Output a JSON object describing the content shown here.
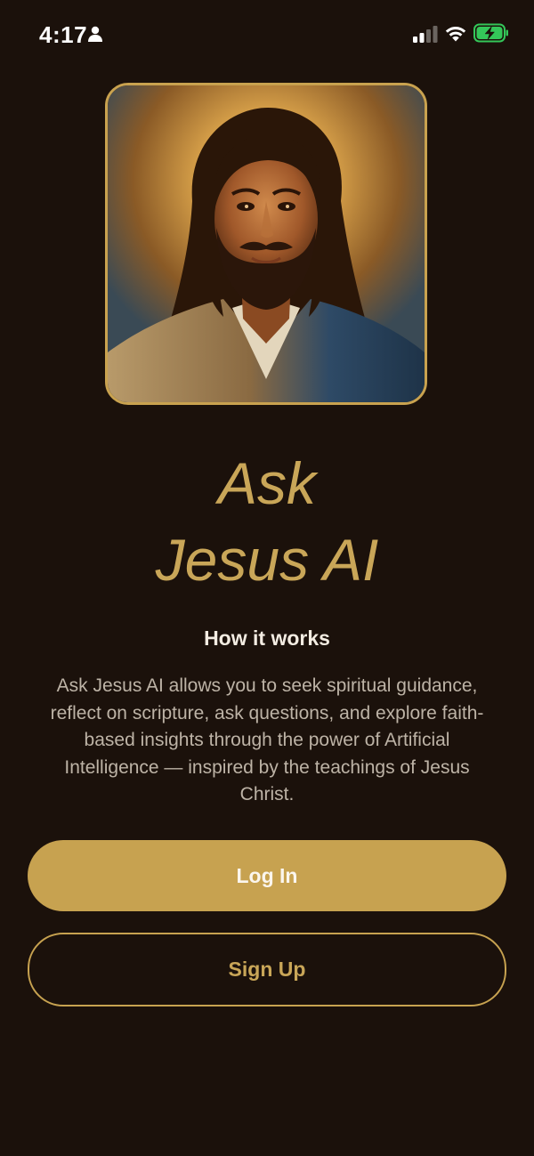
{
  "status_bar": {
    "time": "4:17",
    "icons": [
      "person-icon",
      "cellular-signal-icon",
      "wifi-icon",
      "battery-charging-icon"
    ],
    "battery_color": "#34c759"
  },
  "portrait": {
    "description_icon": "jesus-portrait-image",
    "border_color": "#c9a24f"
  },
  "title": {
    "line1": "Ask",
    "line2": "Jesus AI",
    "color": "#c9a658"
  },
  "how_it_works": {
    "heading": "How it works",
    "body": "Ask Jesus AI allows you to seek spiritual guidance, reflect on scripture, ask questions, and explore faith-based insights through the power of Artificial Intelligence — inspired by the teachings of Jesus Christ."
  },
  "actions": {
    "login_label": "Log In",
    "signup_label": "Sign Up",
    "accent": "#c7a250",
    "background": "#1b110b"
  }
}
